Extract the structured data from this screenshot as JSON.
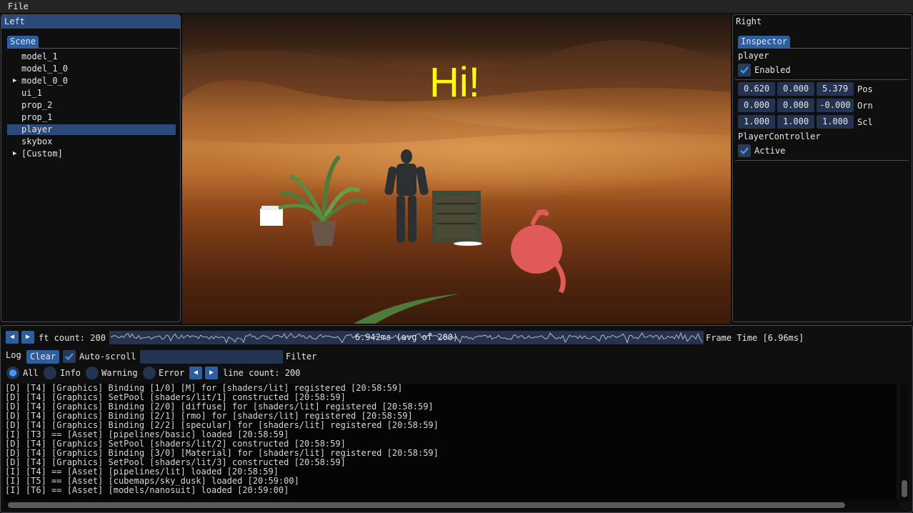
{
  "menubar": {
    "file": "File"
  },
  "left": {
    "title": "Left",
    "tab": "Scene",
    "items": [
      {
        "label": "model_1",
        "expandable": false
      },
      {
        "label": "model_1_0",
        "expandable": false
      },
      {
        "label": "model_0_0",
        "expandable": true
      },
      {
        "label": "ui_1",
        "expandable": false
      },
      {
        "label": "prop_2",
        "expandable": false
      },
      {
        "label": "prop_1",
        "expandable": false
      },
      {
        "label": "player",
        "expandable": false,
        "selected": true
      },
      {
        "label": "skybox",
        "expandable": false
      },
      {
        "label": "[Custom]",
        "expandable": true
      }
    ]
  },
  "viewport": {
    "overlay_text": "Hi!"
  },
  "right": {
    "title": "Right",
    "tab": "Inspector",
    "entity_name": "player",
    "enabled_label": "Enabled",
    "enabled": true,
    "pos": {
      "x": "0.620",
      "y": "0.000",
      "z": "5.379",
      "label": "Pos"
    },
    "orn": {
      "x": "0.000",
      "y": "0.000",
      "z": "-0.000",
      "label": "Orn"
    },
    "scl": {
      "x": "1.000",
      "y": "1.000",
      "z": "1.000",
      "label": "Scl"
    },
    "component": "PlayerController",
    "active_label": "Active",
    "active": true
  },
  "frametime": {
    "count_label": "ft count: 200",
    "plot_label": "6.942ms (avg of 200)",
    "title": "Frame Time [6.96ms]"
  },
  "log": {
    "title": "Log",
    "clear": "Clear",
    "autoscroll": "Auto-scroll",
    "autoscroll_on": true,
    "filter_label": "Filter",
    "filter_value": "",
    "levels": {
      "all": "All",
      "info": "Info",
      "warning": "Warning",
      "error": "Error"
    },
    "line_count": "line count: 200",
    "lines": [
      "[D] [T4] [Graphics] Binding [1/0] [M] for [shaders/lit] registered [20:58:59]",
      "[D] [T4] [Graphics] SetPool [shaders/lit/1] constructed [20:58:59]",
      "[D] [T4] [Graphics] Binding [2/0] [diffuse] for [shaders/lit] registered [20:58:59]",
      "[D] [T4] [Graphics] Binding [2/1] [rmo] for [shaders/lit] registered [20:58:59]",
      "[D] [T4] [Graphics] Binding [2/2] [specular] for [shaders/lit] registered [20:58:59]",
      "[I] [T3] == [Asset] [pipelines/basic] loaded [20:58:59]",
      "[D] [T4] [Graphics] SetPool [shaders/lit/2] constructed [20:58:59]",
      "[D] [T4] [Graphics] Binding [3/0] [Material] for [shaders/lit] registered [20:58:59]",
      "[D] [T4] [Graphics] SetPool [shaders/lit/3] constructed [20:58:59]",
      "[I] [T4] == [Asset] [pipelines/lit] loaded [20:58:59]",
      "[I] [T5] == [Asset] [cubemaps/sky_dusk] loaded [20:59:00]",
      "[I] [T6] == [Asset] [models/nanosuit] loaded [20:59:00]"
    ]
  },
  "colors": {
    "accent": "#2e5da0",
    "selection": "#294a7a",
    "field": "#233350",
    "hi_text": "#ffff00",
    "check": "#4296fa"
  },
  "icons": {
    "check": "check-icon",
    "expand": "triangle-right-icon",
    "prev": "arrow-left-icon",
    "next": "arrow-right-icon"
  }
}
